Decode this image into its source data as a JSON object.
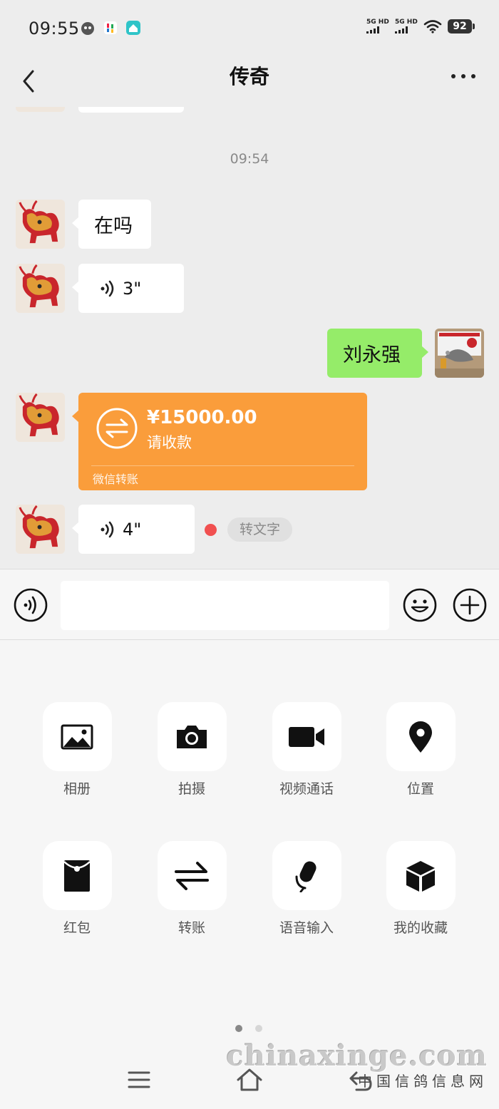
{
  "status_bar": {
    "time": "09:55",
    "network1": "5G HD",
    "network2": "5G HD",
    "battery": "92"
  },
  "header": {
    "title": "传奇",
    "back_icon": "chevron-left-icon",
    "more_icon": "more-icon"
  },
  "chat": {
    "timestamp": "09:54",
    "messages": [
      {
        "side": "left",
        "type": "text",
        "text": "在吗"
      },
      {
        "side": "left",
        "type": "voice",
        "duration": "3\""
      },
      {
        "side": "right",
        "type": "text",
        "text": "刘永强"
      },
      {
        "side": "left",
        "type": "transfer",
        "amount": "¥15000.00",
        "note": "请收款",
        "footer": "微信转账"
      },
      {
        "side": "left",
        "type": "voice",
        "duration": "4\"",
        "unread": true,
        "action": "转文字"
      }
    ]
  },
  "input_bar": {
    "voice_icon": "voice-mode-icon",
    "emoji_icon": "emoji-icon",
    "plus_icon": "plus-icon",
    "value": ""
  },
  "tools": [
    {
      "label": "相册",
      "icon": "photo-album-icon"
    },
    {
      "label": "拍摄",
      "icon": "camera-icon"
    },
    {
      "label": "视频通话",
      "icon": "video-call-icon"
    },
    {
      "label": "位置",
      "icon": "location-icon"
    },
    {
      "label": "红包",
      "icon": "red-packet-icon"
    },
    {
      "label": "转账",
      "icon": "transfer-icon"
    },
    {
      "label": "语音输入",
      "icon": "microphone-icon"
    },
    {
      "label": "我的收藏",
      "icon": "favorites-icon"
    }
  ],
  "pager": {
    "pages": 2,
    "current": 1
  },
  "watermark": {
    "line1": "chinaxinge.com",
    "line2": "中国信鸽信息网"
  },
  "colors": {
    "background": "#ededed",
    "bubble_right": "#95ec69",
    "transfer": "#fa9d3b",
    "unread_dot": "#f15050"
  }
}
